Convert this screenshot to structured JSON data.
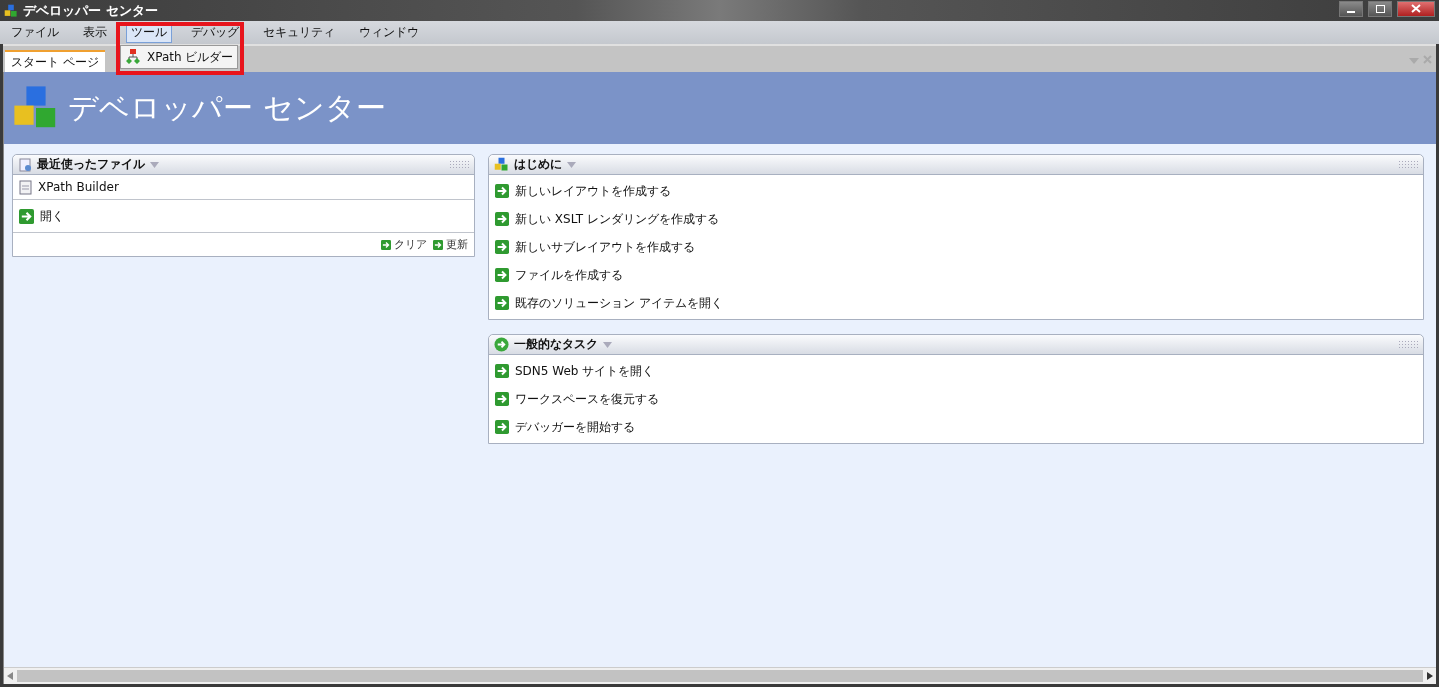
{
  "window": {
    "title": "デベロッパー センター"
  },
  "menu": [
    {
      "label": "ファイル",
      "selected": false
    },
    {
      "label": "表示",
      "selected": false
    },
    {
      "label": "ツール",
      "selected": true
    },
    {
      "label": "デバッグ",
      "selected": false
    },
    {
      "label": "セキュリティ",
      "selected": false
    },
    {
      "label": "ウィンドウ",
      "selected": false
    }
  ],
  "dropdown": {
    "items": [
      {
        "label": "XPath ビルダー"
      }
    ],
    "highlighted": true
  },
  "tabs": [
    {
      "label": "スタート ページ",
      "selected": true
    }
  ],
  "banner": {
    "title": "デベロッパー センター"
  },
  "recent": {
    "title": "最近使ったファイル",
    "files": [
      {
        "label": "XPath Builder"
      }
    ],
    "open": "開く",
    "actions": [
      {
        "label": "クリア"
      },
      {
        "label": "更新"
      }
    ]
  },
  "panels": [
    {
      "title": "はじめに",
      "items": [
        {
          "label": "新しいレイアウトを作成する"
        },
        {
          "label": "新しい XSLT レンダリングを作成する"
        },
        {
          "label": "新しいサブレイアウトを作成する"
        },
        {
          "label": "ファイルを作成する"
        },
        {
          "label": "既存のソリューション アイテムを開く"
        }
      ]
    },
    {
      "title": "一般的なタスク",
      "items": [
        {
          "label": "SDN5 Web サイトを開く"
        },
        {
          "label": "ワークスペースを復元する"
        },
        {
          "label": "デバッガーを開始する"
        }
      ]
    }
  ]
}
